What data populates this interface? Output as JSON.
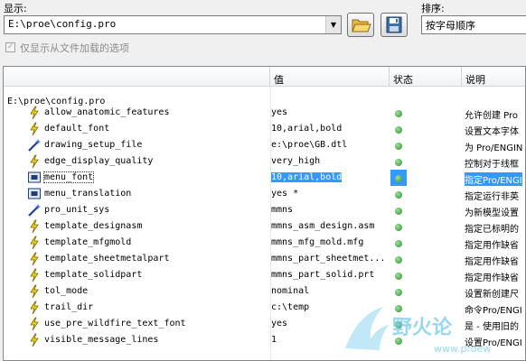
{
  "top": {
    "display_label": "显示:",
    "sort_label": "排序:",
    "file_path": "E:\\proe\\config.pro",
    "sort_value": "按字母顺序",
    "show_loaded_only": "仅显示从文件加载的选项",
    "show_loaded_only_checked": true
  },
  "columns": {
    "value": "值",
    "status": "状态",
    "desc": "说明"
  },
  "tree_root": "E:\\proe\\config.pro",
  "options": [
    {
      "name": "allow_anatomic_features",
      "value": "yes",
      "desc": "允许创建 Pro",
      "icon": "lightning-icon"
    },
    {
      "name": "default_font",
      "value": "10,arial,bold",
      "desc": "设置文本字体",
      "icon": "lightning-icon"
    },
    {
      "name": "drawing_setup_file",
      "value": "e:\\proe\\GB.dtl",
      "desc": "为 Pro/ENGIN",
      "icon": "wand-icon"
    },
    {
      "name": "edge_display_quality",
      "value": "very_high",
      "desc": "控制对于线框",
      "icon": "lightning-icon"
    },
    {
      "name": "menu_font",
      "value": "10,arial,bold",
      "desc": "指定Pro/ENGI",
      "icon": "screen-icon",
      "selected": true
    },
    {
      "name": "menu_translation",
      "value": "yes *",
      "desc": "指定运行非英",
      "icon": "screen-icon"
    },
    {
      "name": "pro_unit_sys",
      "value": "mmns",
      "desc": "为新模型设置",
      "icon": "wand-icon"
    },
    {
      "name": "template_designasm",
      "value": "mmns_asm_design.asm",
      "desc": "指定已标明的",
      "icon": "lightning-icon"
    },
    {
      "name": "template_mfgmold",
      "value": "mmns_mfg_mold.mfg",
      "desc": "指定用作缺省",
      "icon": "lightning-icon"
    },
    {
      "name": "template_sheetmetalpart",
      "value": "mmns_part_sheetmet...",
      "desc": "指定用作缺省",
      "icon": "lightning-icon"
    },
    {
      "name": "template_solidpart",
      "value": "mmns_part_solid.prt",
      "desc": "指定用作缺省",
      "icon": "lightning-icon"
    },
    {
      "name": "tol_mode",
      "value": "nominal",
      "desc": "设置新创建尺",
      "icon": "lightning-icon"
    },
    {
      "name": "trail_dir",
      "value": "c:\\temp",
      "desc": "命令Pro/ENGI",
      "icon": "lightning-icon"
    },
    {
      "name": "use_pre_wildfire_text_font",
      "value": "yes",
      "desc": "是 - 使用旧的",
      "icon": "lightning-icon"
    },
    {
      "name": "visible_message_lines",
      "value": "1",
      "desc": "设置Pro/ENGI",
      "icon": "lightning-icon"
    }
  ],
  "watermark": {
    "text": "野火论",
    "url": "www.proew"
  },
  "colors": {
    "selection": "#3399ff",
    "status_ok": "#2f8f2f",
    "watermark": "#6fc6ea"
  }
}
